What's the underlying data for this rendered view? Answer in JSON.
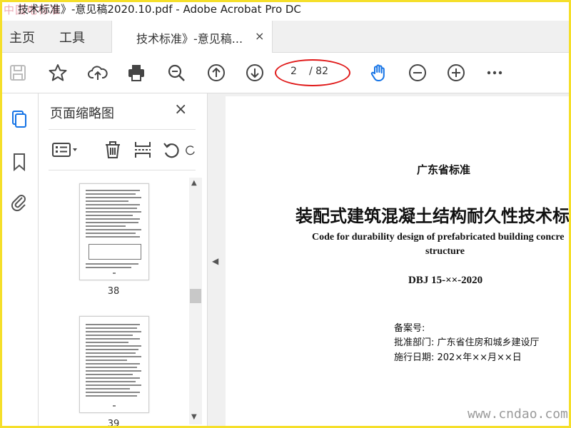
{
  "window": {
    "title": "技术标准》-意见稿2020.10.pdf - Adobe Acrobat Pro DC",
    "logo_text": "中国电标准"
  },
  "tabbar": {
    "home": "主页",
    "tools": "工具",
    "doc_tab": "技术标准》-意见稿...",
    "close": "×"
  },
  "toolbar": {
    "page_current": "2",
    "page_total": "/ 82"
  },
  "thumbnails_panel": {
    "title": "页面缩略图",
    "close": "×",
    "pages": [
      {
        "label": "38"
      },
      {
        "label": "39"
      }
    ]
  },
  "document": {
    "org": "广东省标准",
    "title_cn": "装配式建筑混凝土结构耐久性技术标",
    "title_en_1": "Code for durability design of prefabricated building concre",
    "title_en_2": "structure",
    "code": "DBJ 15-××-2020",
    "record_no": "备案号:",
    "approved_by": "批准部门: 广东省住房和城乡建设厅",
    "effective_date": "施行日期: 202×年××月××日"
  },
  "watermark": "www.cndao.com",
  "colors": {
    "accent": "#1473e6",
    "highlight": "#e01818",
    "border": "#f5df2a"
  }
}
